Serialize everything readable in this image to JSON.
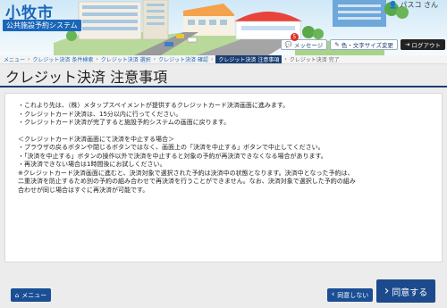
{
  "header": {
    "city_name": "小牧市",
    "system_name": "公共施設予約システム",
    "user_name": "パスコ さん",
    "buttons": {
      "messages": "メッセージ",
      "messages_count": "5",
      "accessibility": "色・文字サイズ変更",
      "logout": "ログアウト"
    }
  },
  "breadcrumb": [
    {
      "label": "メニュー",
      "state": "link"
    },
    {
      "label": "クレジット決済 条件検索",
      "state": "link"
    },
    {
      "label": "クレジット決済 選択",
      "state": "link"
    },
    {
      "label": "クレジット決済 確認",
      "state": "link"
    },
    {
      "label": "クレジット決済 注意事項",
      "state": "current"
    },
    {
      "label": "クレジット決済 完了",
      "state": "future"
    }
  ],
  "page": {
    "title": "クレジット決済 注意事項"
  },
  "notice": {
    "lines_1": [
      "・これより先は、（株）メタップスペイメントが提供するクレジットカード決済画面に進みます。",
      "・クレジットカード決済は、15分以内に行ってください。",
      "・クレジットカード決済が完了すると施設予約システムの画面に戻ります。"
    ],
    "lines_2": [
      "＜クレジットカード決済画面にて決済を中止する場合＞",
      "・ブラウザの戻るボタンや閉じるボタンではなく、画面上の「決済を中止する」ボタンで中止してください。",
      "・「決済を中止する」ボタンの操作以外で決済を中止すると対象の予約が再決済できなくなる場合があります。",
      "・再決済できない場合は1時間後にお試しください。",
      "※クレジットカード決済画面に進むと、決済対象で選択された予約は決済中の状態となります。決済中となった予約は、",
      "二重決済を防止するため別の予約の組み合わせで再決済を行うことができません。なお、決済対象で選択した予約の組み",
      "合わせが同じ場合はすぐに再決済が可能です。"
    ]
  },
  "footer": {
    "menu_label": "メニュー",
    "disagree_label": "同意しない",
    "agree_label": "同意する"
  },
  "colors": {
    "primary": "#1a4f95",
    "breadcrumb_current": "#1a3f73",
    "badge": "#e0302a"
  }
}
